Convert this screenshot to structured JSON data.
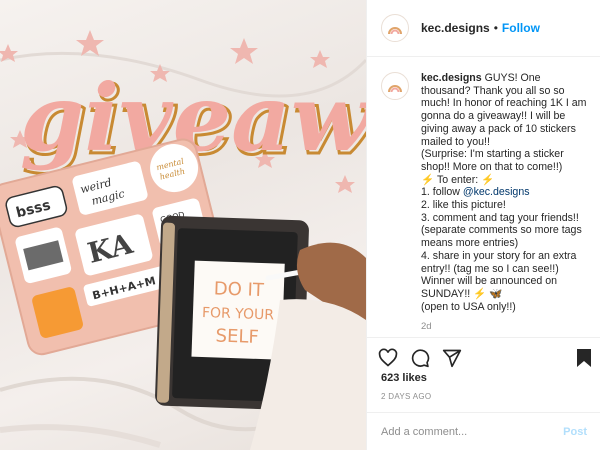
{
  "post": {
    "username": "kec.designs",
    "follow_label": "Follow",
    "separator": "•",
    "image": {
      "headline": "giveaway",
      "ipad_text": [
        "DO IT",
        "FOR YOUR",
        "SELF"
      ],
      "stickers": [
        "bsss",
        "weird magic",
        "Good Times Roll",
        "mental health matters",
        "KA",
        "B+H+A+M"
      ]
    },
    "caption": {
      "username": "kec.designs",
      "lines": [
        "GUYS! One thousand? Thank you all so so much! In honor of reaching 1K I am gonna do a giveaway!! I will be giving away a pack of 10 stickers mailed to you!!",
        "(Surprise: I'm starting a sticker shop!! More on that to come!!)",
        "⚡ To enter: ⚡",
        "1. follow @kec.designs",
        "2. like this picture!",
        "3. comment and tag your friends!! (separate comments so more tags means more entries)",
        "4. share in your story for an extra entry!! (tag me so I can see!!)",
        "Winner will be announced on SUNDAY!! ⚡ 🦋",
        "(open to USA only!!)"
      ],
      "time": "2d"
    },
    "likes": "623 likes",
    "posted_ago": "2 DAYS AGO",
    "comment": {
      "placeholder": "Add a comment...",
      "post_label": "Post"
    }
  },
  "colors": {
    "follow": "#0095f6",
    "mention": "#00376b",
    "headline_pink": "#f2a9a1",
    "headline_shadow": "#c88a33"
  },
  "icons": [
    "heart-icon",
    "comment-icon",
    "share-icon",
    "bookmark-icon",
    "rainbow-logo-icon"
  ]
}
